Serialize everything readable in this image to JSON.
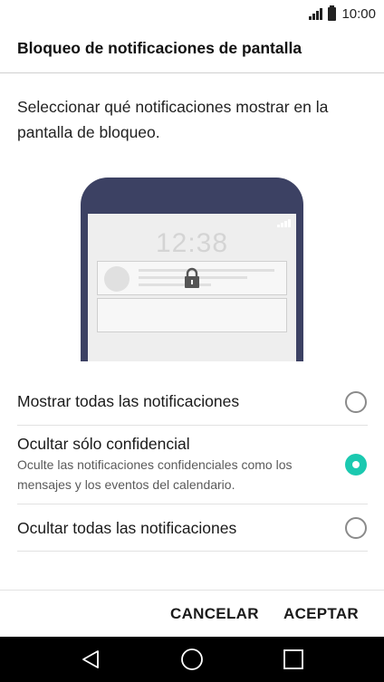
{
  "status_bar": {
    "time": "10:00",
    "signal_icon": "signal-icon",
    "battery_icon": "battery-icon"
  },
  "app_bar": {
    "title": "Bloqueo de notificaciones de pantalla"
  },
  "description": "Seleccionar qué notificaciones mostrar en la pantalla de bloqueo.",
  "illustration": {
    "clock": "12:38",
    "lock_icon": "lock-icon"
  },
  "options": [
    {
      "label": "Mostrar todas las notificaciones",
      "sublabel": "",
      "selected": false
    },
    {
      "label": "Ocultar sólo confidencial",
      "sublabel": "Oculte las notificaciones confidenciales como los mensajes y los eventos del calendario.",
      "selected": true
    },
    {
      "label": "Ocultar todas las notificaciones",
      "sublabel": "",
      "selected": false
    }
  ],
  "buttons": {
    "cancel": "CANCELAR",
    "accept": "ACEPTAR"
  },
  "nav": {
    "back_icon": "back-icon",
    "home_icon": "home-icon",
    "recents_icon": "recents-icon"
  },
  "colors": {
    "accent": "#1bc9b0",
    "phone_frame": "#3c4163",
    "nav_bar": "#000000"
  }
}
